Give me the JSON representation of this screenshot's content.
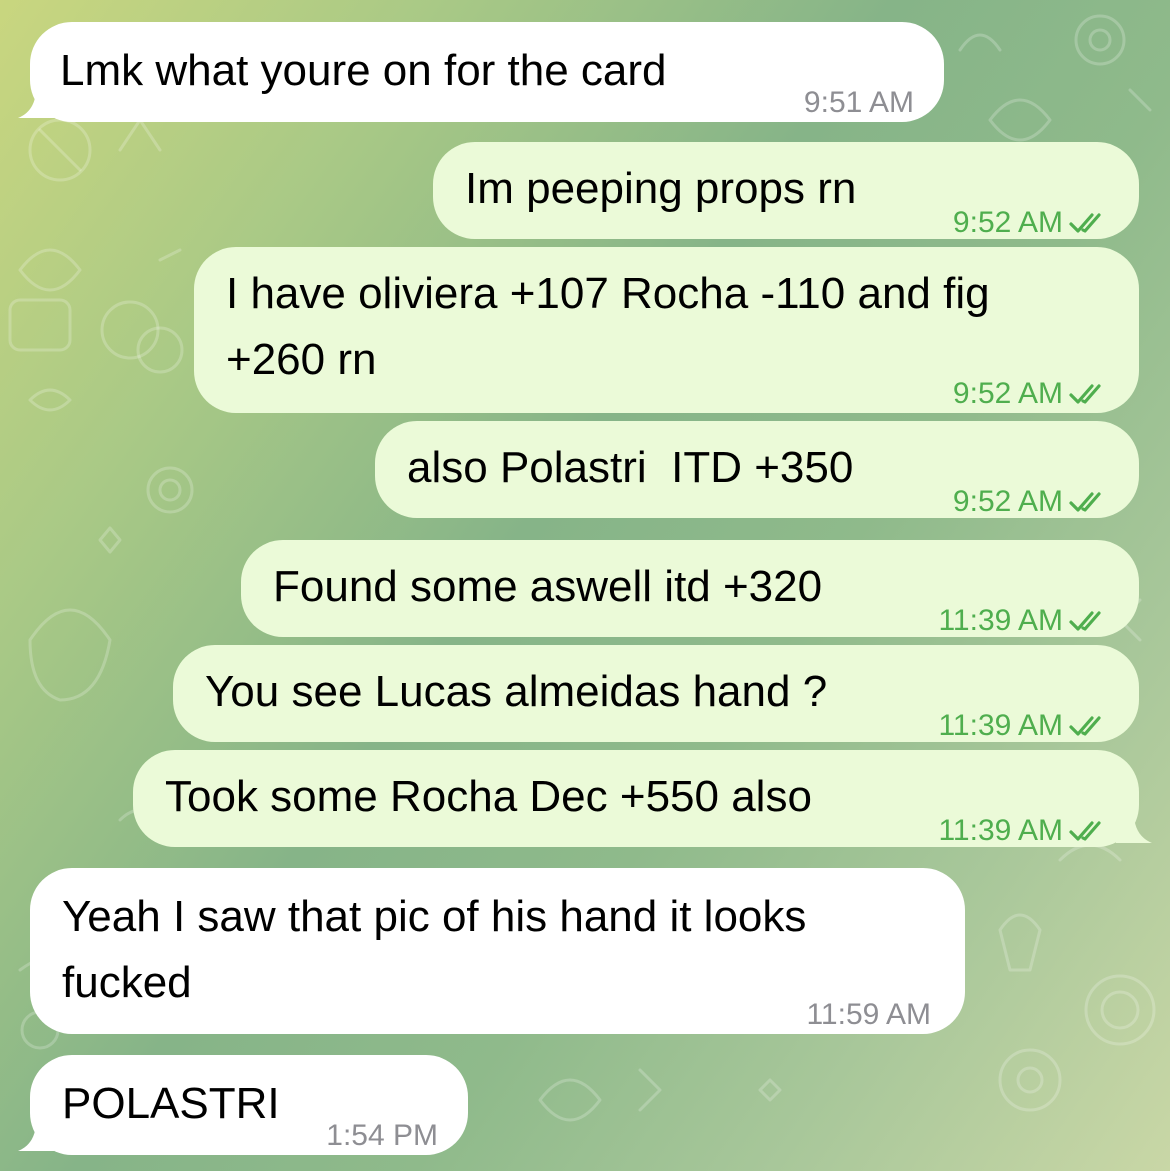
{
  "colors": {
    "incoming_bubble": "#ffffff",
    "outgoing_bubble": "#ebfad8",
    "outgoing_meta": "#4fae4e",
    "incoming_meta": "#8e8e93"
  },
  "messages": [
    {
      "direction": "incoming",
      "text": "Lmk what youre on for the card",
      "time": "9:51 AM"
    },
    {
      "direction": "outgoing",
      "text": "Im peeping props rn",
      "time": "9:52 AM",
      "status": "read"
    },
    {
      "direction": "outgoing",
      "text_line1": "I have oliviera +107 Rocha -110 and fig",
      "text_line2": "+260 rn",
      "time": "9:52 AM",
      "status": "read"
    },
    {
      "direction": "outgoing",
      "text": "also Polastri  ITD +350",
      "time": "9:52 AM",
      "status": "read"
    },
    {
      "direction": "outgoing",
      "text": "Found some aswell itd +320",
      "time": "11:39 AM",
      "status": "read"
    },
    {
      "direction": "outgoing",
      "text": "You see Lucas almeidas hand ?",
      "time": "11:39 AM",
      "status": "read"
    },
    {
      "direction": "outgoing",
      "text": "Took some Rocha Dec +550 also",
      "time": "11:39 AM",
      "status": "read"
    },
    {
      "direction": "incoming",
      "text_line1": "Yeah I saw that pic of his hand it looks",
      "text_line2": "fucked",
      "time": "11:59 AM"
    },
    {
      "direction": "incoming",
      "text": "POLASTRI",
      "time": "1:54 PM"
    }
  ],
  "icons": {
    "read_receipt": "double-check-icon"
  }
}
